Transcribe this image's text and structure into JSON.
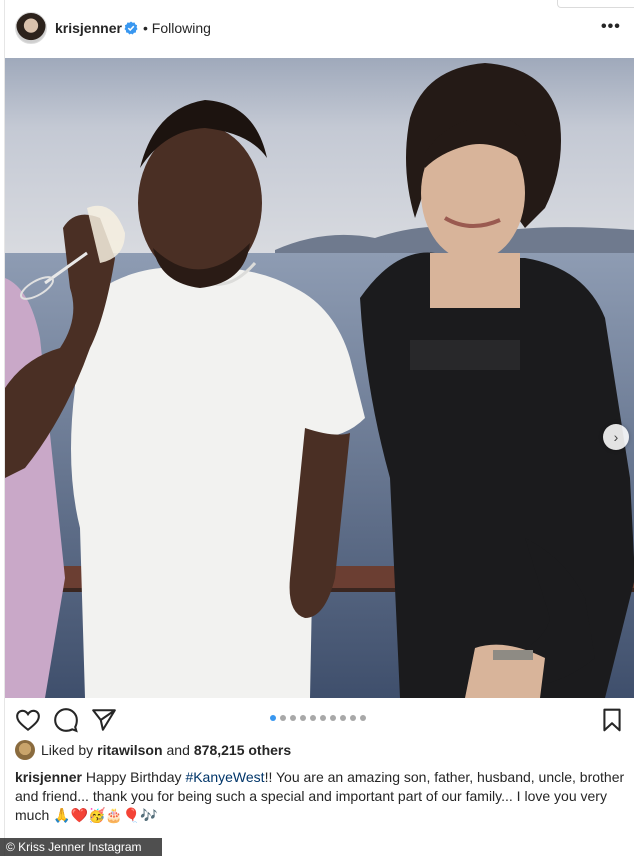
{
  "post": {
    "username": "krisjenner",
    "separator": "•",
    "follow_status": "Following",
    "more_glyph": "•••"
  },
  "photo": {
    "next_glyph": "›",
    "carousel_count": 10,
    "carousel_active_index": 0
  },
  "likes": {
    "prefix": "Liked by",
    "liker": "ritawilson",
    "middle": "and",
    "count": "878,215 others"
  },
  "caption": {
    "username": "krisjenner",
    "text_before": " Happy Birthday ",
    "hashtag": "#KanyeWest",
    "text_after": "!! You are an amazing son, father, husband, uncle, brother and friend... thank you for being such a special and important part of our family... I love you very much 🙏❤️🥳🎂🎈🎶"
  },
  "credit": "© Kriss Jenner Instagram",
  "colors": {
    "accent_blue": "#3897f0",
    "verified_blue": "#3897f0",
    "text": "#262626",
    "hashtag": "#003569"
  },
  "icons": [
    "heart-icon",
    "comment-icon",
    "share-icon",
    "bookmark-icon",
    "verified-icon",
    "chevron-right-icon"
  ]
}
